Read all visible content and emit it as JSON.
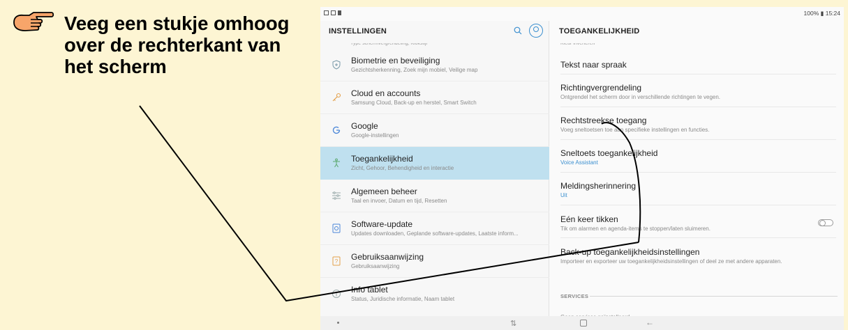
{
  "instruction": {
    "text": "Veeg een stukje omhoog over de rechterkant van het scherm",
    "hand_icon": "pointing-hand-icon"
  },
  "statusbar": {
    "battery": "100%",
    "time": "15:24"
  },
  "left_pane": {
    "title": "INSTELLINGEN",
    "search_icon": "search-icon",
    "account_icon": "account-icon",
    "cut_item": "Type schermvergrendeling, Klokstijl",
    "items": [
      {
        "title": "Biometrie en beveiliging",
        "subtitle": "Gezichtsherkenning, Zoek mijn mobiel, Veilige map",
        "icon": "shield-icon"
      },
      {
        "title": "Cloud en accounts",
        "subtitle": "Samsung Cloud, Back-up en herstel, Smart Switch",
        "icon": "key-icon"
      },
      {
        "title": "Google",
        "subtitle": "Google-instellingen",
        "icon": "google-icon"
      },
      {
        "title": "Toegankelijkheid",
        "subtitle": "Zicht, Gehoor, Behendigheid en interactie",
        "icon": "accessibility-icon",
        "selected": true
      },
      {
        "title": "Algemeen beheer",
        "subtitle": "Taal en invoer, Datum en tijd, Resetten",
        "icon": "sliders-icon"
      },
      {
        "title": "Software-update",
        "subtitle": "Updates downloaden, Geplande software-updates, Laatste inform...",
        "icon": "update-icon"
      },
      {
        "title": "Gebruiksaanwijzing",
        "subtitle": "Gebruiksaanwijzing",
        "icon": "manual-icon"
      },
      {
        "title": "Info tablet",
        "subtitle": "Status, Juridische informatie, Naam tablet",
        "icon": "info-icon"
      }
    ]
  },
  "right_pane": {
    "title": "TOEGANKELIJKHEID",
    "cut_item": "Kleur inverteren",
    "items": [
      {
        "title": "Tekst naar spraak",
        "subtitle": ""
      },
      {
        "title": "Richtingvergrendeling",
        "subtitle": "Ontgrendel het scherm door in verschillende richtingen te vegen."
      },
      {
        "title": "Rechtstreekse toegang",
        "subtitle": "Voeg sneltoetsen toe aan specifieke instellingen en functies."
      },
      {
        "title": "Sneltoets toegankelijkheid",
        "subtitle": "Voice Assistant",
        "subtitle_blue": true
      },
      {
        "title": "Meldingsherinnering",
        "subtitle": "Uit",
        "subtitle_blue": true
      },
      {
        "title": "Eén keer tikken",
        "subtitle": "Tik om alarmen en agenda-items te stoppen/laten sluimeren.",
        "toggle": false
      },
      {
        "title": "Back-up toegankelijkheidsinstellingen",
        "subtitle": "Importeer en exporteer uw toegankelijkheidsinstellingen of deel ze met andere apparaten."
      }
    ],
    "services_label": "SERVICES",
    "services_empty": "Geen services geïnstalleerd."
  },
  "navbar": {
    "recent_icon": "recent-apps-icon",
    "home_icon": "home-icon",
    "back_icon": "back-icon"
  },
  "colors": {
    "background": "#fdf5d3",
    "selected_row": "#bfe0ef",
    "accent": "#3b8fcf",
    "hand": "#f7a56a"
  }
}
